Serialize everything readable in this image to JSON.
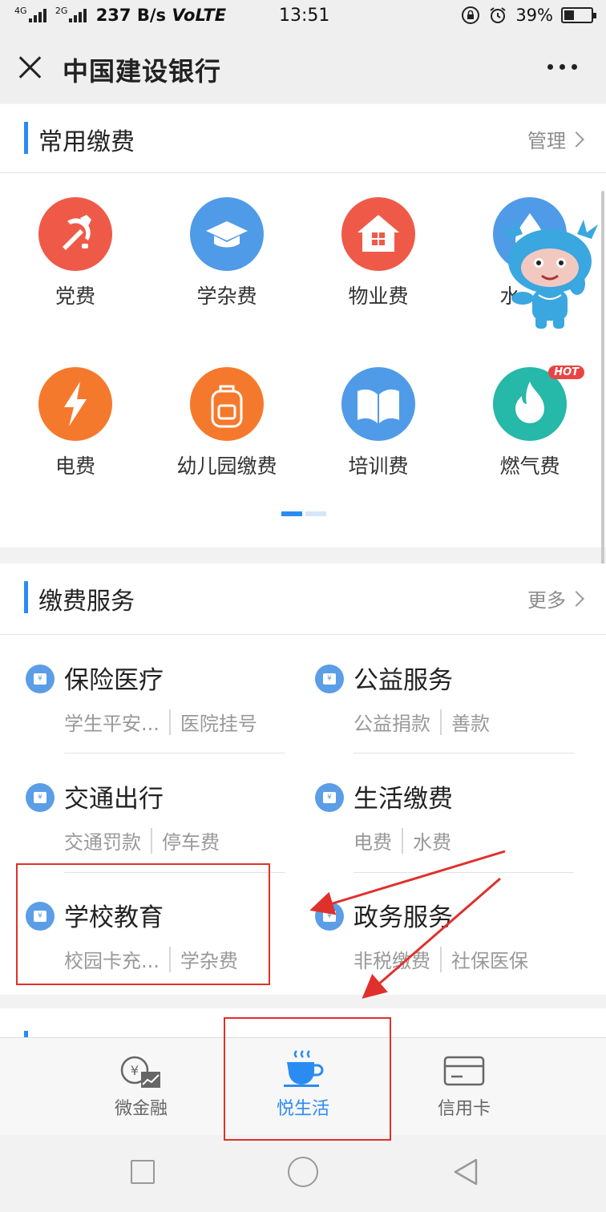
{
  "status_bar": {
    "network": "237 B/s",
    "volte": "VoLTE",
    "net_labels": [
      "4G",
      "2G"
    ],
    "time": "13:51",
    "battery": "39%",
    "battery_level": 0.39
  },
  "header": {
    "title": "中国建设银行",
    "close_icon": "close-icon",
    "more_icon": "more-dots-icon"
  },
  "common_fees": {
    "title": "常用缴费",
    "manage_label": "管理",
    "page_indicator": {
      "pages": 2,
      "current": 1
    },
    "items": [
      {
        "label": "党费",
        "icon": "party-emblem-icon",
        "color": "#ef5a48"
      },
      {
        "label": "学杂费",
        "icon": "graduation-cap-icon",
        "color": "#4f9be8"
      },
      {
        "label": "物业费",
        "icon": "house-icon",
        "color": "#ef5a48"
      },
      {
        "label": "水费",
        "icon": "water-drop-icon",
        "color": "#4f9be8",
        "visible_label": "水"
      },
      {
        "label": "电费",
        "icon": "lightning-icon",
        "color": "#f5792c"
      },
      {
        "label": "幼儿园缴费",
        "icon": "backpack-icon",
        "color": "#f5792c"
      },
      {
        "label": "培训费",
        "icon": "book-icon",
        "color": "#4f9be8"
      },
      {
        "label": "燃气费",
        "icon": "flame-icon",
        "color": "#26b8a8",
        "badge": "HOT"
      }
    ]
  },
  "payment_services": {
    "title": "缴费服务",
    "more_label": "更多",
    "items": [
      {
        "name": "保险医疗",
        "subs": [
          "学生平安...",
          "医院挂号"
        ]
      },
      {
        "name": "公益服务",
        "subs": [
          "公益捐款",
          "善款"
        ]
      },
      {
        "name": "交通出行",
        "subs": [
          "交通罚款",
          "停车费"
        ]
      },
      {
        "name": "生活缴费",
        "subs": [
          "电费",
          "水费"
        ]
      },
      {
        "name": "学校教育",
        "subs": [
          "校园卡充...",
          "学杂费"
        ]
      },
      {
        "name": "政务服务",
        "subs": [
          "非税缴费",
          "社保医保"
        ]
      }
    ]
  },
  "tab_bar": {
    "tabs": [
      {
        "label": "微金融",
        "icon": "coin-chart-icon",
        "active": false
      },
      {
        "label": "悦生活",
        "icon": "cup-icon",
        "active": true
      },
      {
        "label": "信用卡",
        "icon": "credit-card-icon",
        "active": false
      }
    ]
  },
  "colors": {
    "accent": "#2a8cf2",
    "annotation_red": "#e0302b"
  }
}
